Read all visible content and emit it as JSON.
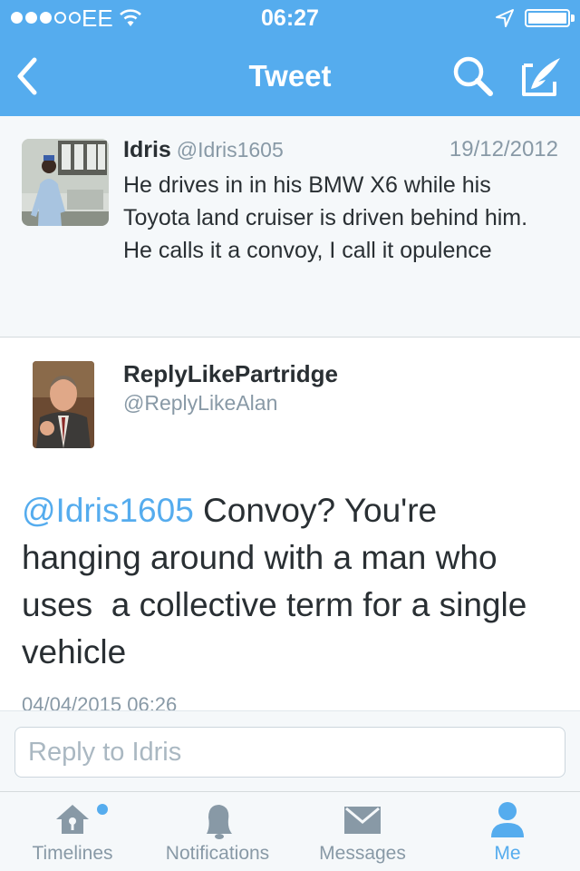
{
  "status_bar": {
    "carrier": "EE",
    "time": "06:27"
  },
  "nav": {
    "title": "Tweet",
    "icons": [
      "back-chevron-icon",
      "search-icon",
      "compose-icon"
    ]
  },
  "parent_tweet": {
    "name": "Idris",
    "handle": "@Idris1605",
    "date": "19/12/2012",
    "text": "He drives in in his BMW X6 while his Toyota land cruiser is driven behind him. He calls it a convoy, I call it opulence"
  },
  "main_tweet": {
    "name": "ReplyLikePartridge",
    "handle": "@ReplyLikeAlan",
    "mention": "@Idris1605",
    "text": " Convoy? You're hanging around with a man who uses  a collective term for a single vehicle",
    "timestamp": "04/04/2015 06:26"
  },
  "reply": {
    "placeholder": "Reply to Idris"
  },
  "tabs": [
    {
      "label": "Timelines",
      "icon": "home-icon",
      "active": false
    },
    {
      "label": "Notifications",
      "icon": "bell-icon",
      "active": false
    },
    {
      "label": "Messages",
      "icon": "envelope-icon",
      "active": false
    },
    {
      "label": "Me",
      "icon": "person-icon",
      "active": true
    }
  ],
  "colors": {
    "brand": "#55acee",
    "text": "#292f33",
    "muted": "#8899a6",
    "background_gray": "#f5f8fa"
  }
}
